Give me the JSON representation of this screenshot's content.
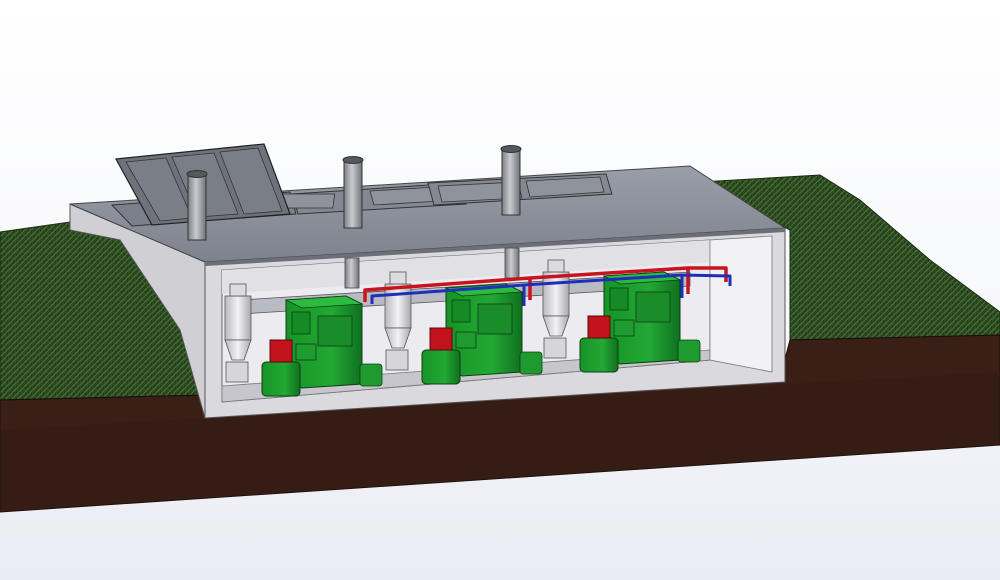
{
  "scene": {
    "description_visible": false,
    "colors": {
      "background_top": "#ffffff",
      "background_bottom": "#e6e9f0",
      "grass": "#2d4a22",
      "grass_light": "#3d6b2c",
      "soil_front": "#3b1f17",
      "soil_side": "#2c1610",
      "building_wall": "#d4d4d8",
      "building_inner": "#e4e4e8",
      "building_floor": "#c7c7cc",
      "roof": "#8a8d96",
      "roof_edge": "#6e717a",
      "solar_panel": "#6b6f78",
      "chimney": "#9a9ca3",
      "boiler_green": "#1e9a2e",
      "boiler_green_dark": "#137022",
      "boiler_red": "#c2121c",
      "pipe_red": "#c8141e",
      "pipe_blue": "#1e2fb8",
      "cyclone": "#e6e6ea",
      "outline": "#222222"
    },
    "boiler_units": [
      {
        "id": "unit-1"
      },
      {
        "id": "unit-2"
      },
      {
        "id": "unit-3"
      }
    ],
    "chimneys": 3,
    "roof_panels": 6
  }
}
